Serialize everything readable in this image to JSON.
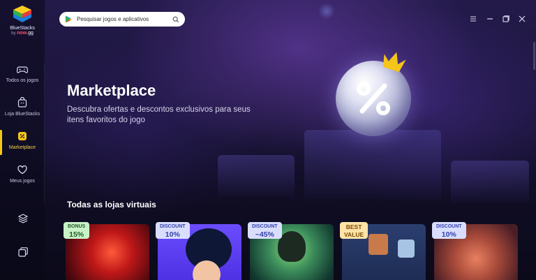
{
  "app": {
    "name": "BlueStacks",
    "by": "by",
    "brand_now": "now",
    "brand_gg": ".gg"
  },
  "search": {
    "placeholder": "Pesquisar jogos e aplicativos"
  },
  "sidebar": {
    "items": [
      {
        "label": "Todos os jogos",
        "icon": "gamepad-icon"
      },
      {
        "label": "Loja BlueStacks",
        "icon": "store-bag-icon"
      },
      {
        "label": "Marketplace",
        "icon": "percent-tag-icon",
        "active": true
      },
      {
        "label": "Meus jogos",
        "icon": "heart-icon"
      }
    ],
    "bottom_icons": [
      "layers-icon",
      "multi-instance-icon"
    ]
  },
  "window_controls": [
    "menu-icon",
    "minimize-icon",
    "restore-icon",
    "close-icon"
  ],
  "hero": {
    "title": "Marketplace",
    "subtitle": "Descubra ofertas e descontos exclusivos para seus itens favoritos do jogo"
  },
  "section": {
    "title": "Todas as lojas virtuais"
  },
  "cards": [
    {
      "badge_top": "BONUS",
      "badge_bottom": "15%",
      "badge_color": "#c9f2c8"
    },
    {
      "badge_top": "DISCOUNT",
      "badge_bottom": "10%",
      "badge_color": "#d9deff"
    },
    {
      "badge_top": "DISCOUNT",
      "badge_bottom": "~45%",
      "badge_color": "#d9deff"
    },
    {
      "badge_top": "BEST",
      "badge_bottom": "VALUE",
      "badge_color": "#ffe3a8"
    },
    {
      "badge_top": "DISCOUNT",
      "badge_bottom": "10%",
      "badge_color": "#d9deff"
    }
  ],
  "colors": {
    "accent": "#f5c518",
    "background": "#1a1438"
  }
}
